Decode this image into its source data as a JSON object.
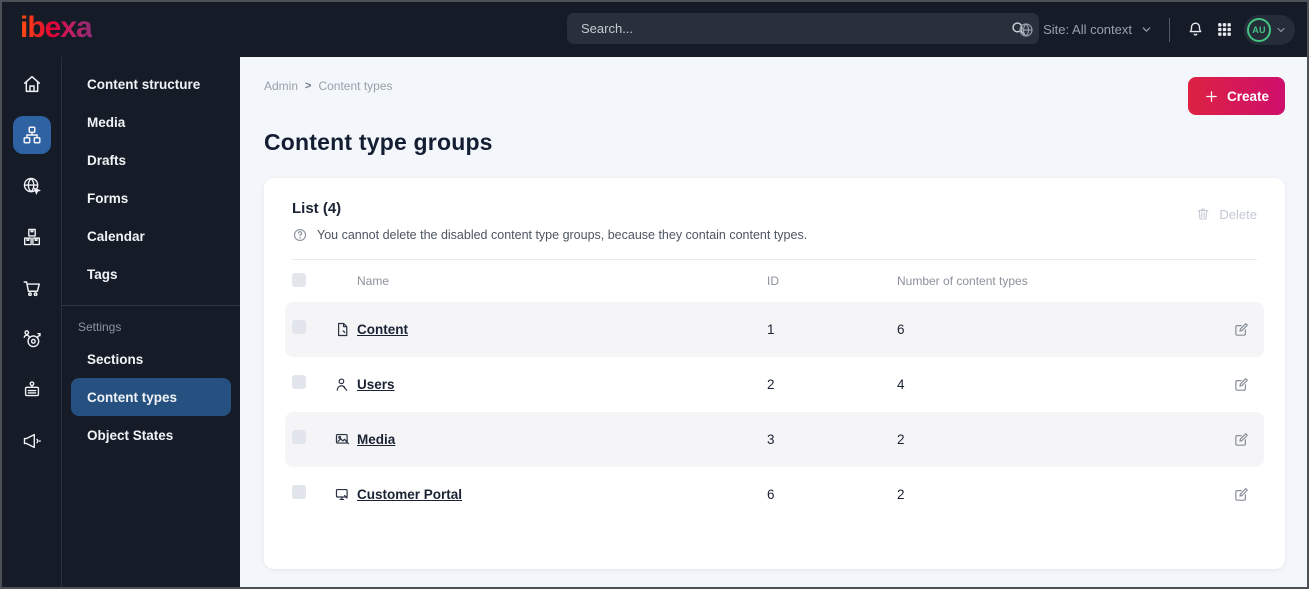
{
  "topbar": {
    "logo_text": "ibexa",
    "search_placeholder": "Search...",
    "site_selector": "Site: All context",
    "avatar_initials": "AU"
  },
  "sidebar": {
    "menu_items": [
      "Content structure",
      "Media",
      "Drafts",
      "Forms",
      "Calendar",
      "Tags"
    ],
    "settings_label": "Settings",
    "settings_items": [
      "Sections",
      "Content types",
      "Object States"
    ],
    "active_item": "Content types"
  },
  "page": {
    "breadcrumb": {
      "items": [
        "Admin",
        "Content types"
      ],
      "separator": ">"
    },
    "create_button": "Create",
    "title": "Content type groups"
  },
  "list_card": {
    "title": "List (4)",
    "info": "You cannot delete the disabled content type groups, because they contain content types.",
    "delete_button": "Delete",
    "columns": {
      "name": "Name",
      "id": "ID",
      "count": "Number of content types"
    },
    "rows": [
      {
        "icon": "file-icon",
        "name": "Content",
        "id": "1",
        "count": "6"
      },
      {
        "icon": "user-icon",
        "name": "Users",
        "id": "2",
        "count": "4"
      },
      {
        "icon": "image-icon",
        "name": "Media",
        "id": "3",
        "count": "2"
      },
      {
        "icon": "portal-icon",
        "name": "Customer Portal",
        "id": "6",
        "count": "2"
      }
    ]
  },
  "colors": {
    "topbar_bg": "#151c27",
    "rail_active_blue": "#2e62a2",
    "menu_active_blue": "#25507f",
    "create_gradient_start": "#dd2243",
    "create_gradient_end": "#ce0f6c",
    "avatar_green": "#43c280",
    "main_bg": "#f3f6fa",
    "row_stripe": "#f5f5f7"
  }
}
